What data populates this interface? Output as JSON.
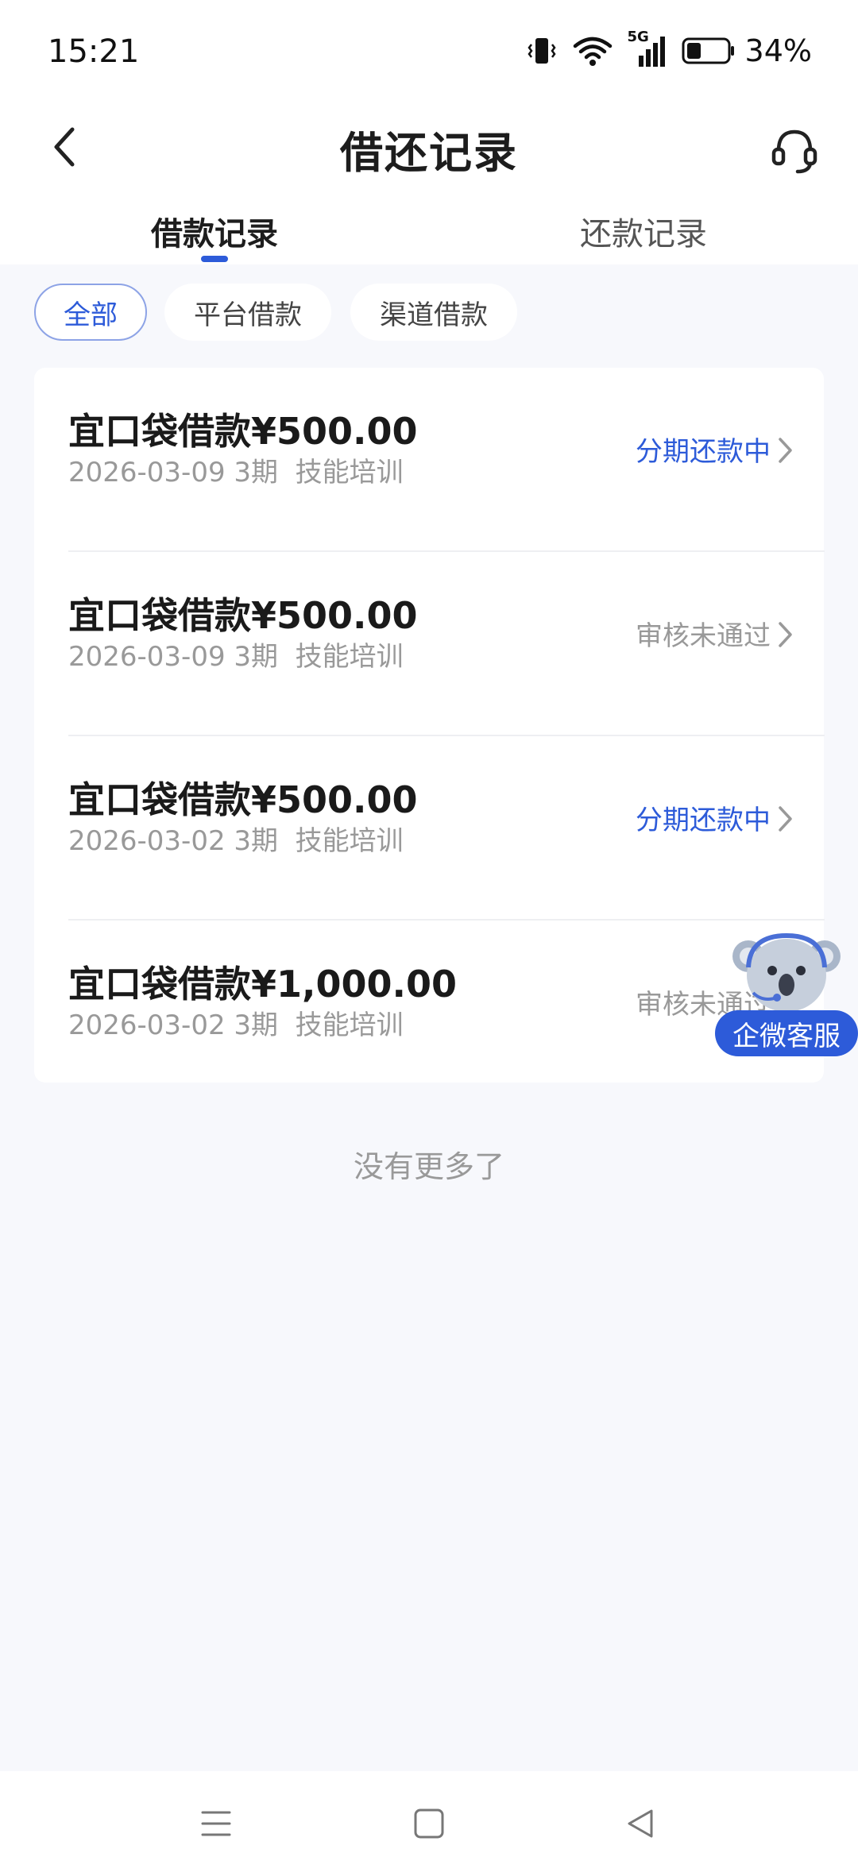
{
  "status_bar": {
    "time": "15:21",
    "network": "5G",
    "battery_percent": "34%",
    "battery_level": 0.34
  },
  "header": {
    "title": "借还记录"
  },
  "tabs": [
    {
      "label": "借款记录",
      "active": true
    },
    {
      "label": "还款记录",
      "active": false
    }
  ],
  "filters": [
    {
      "label": "全部",
      "selected": true
    },
    {
      "label": "平台借款",
      "selected": false
    },
    {
      "label": "渠道借款",
      "selected": false
    }
  ],
  "loans": [
    {
      "title": "宜口袋借款¥500.00",
      "date_terms": "2026-03-09 3期",
      "purpose": "技能培训",
      "status": "分期还款中",
      "status_type": "active"
    },
    {
      "title": "宜口袋借款¥500.00",
      "date_terms": "2026-03-09 3期",
      "purpose": "技能培训",
      "status": "审核未通过",
      "status_type": "rejected"
    },
    {
      "title": "宜口袋借款¥500.00",
      "date_terms": "2026-03-02 3期",
      "purpose": "技能培训",
      "status": "分期还款中",
      "status_type": "active"
    },
    {
      "title": "宜口袋借款¥1,000.00",
      "date_terms": "2026-03-02 3期",
      "purpose": "技能培训",
      "status": "审核未通过",
      "status_type": "rejected"
    }
  ],
  "footer_text": "没有更多了",
  "floating_service": {
    "label": "企微客服"
  },
  "icons": {
    "back": "chevron-left-icon",
    "service": "headset-icon",
    "row_arrow": "chevron-right-icon",
    "nav_menu": "menu-icon",
    "nav_home": "home-square-icon",
    "nav_back": "triangle-back-icon"
  },
  "colors": {
    "accent": "#2d5bd9",
    "background": "#f7f8fc",
    "muted_text": "#999999"
  }
}
